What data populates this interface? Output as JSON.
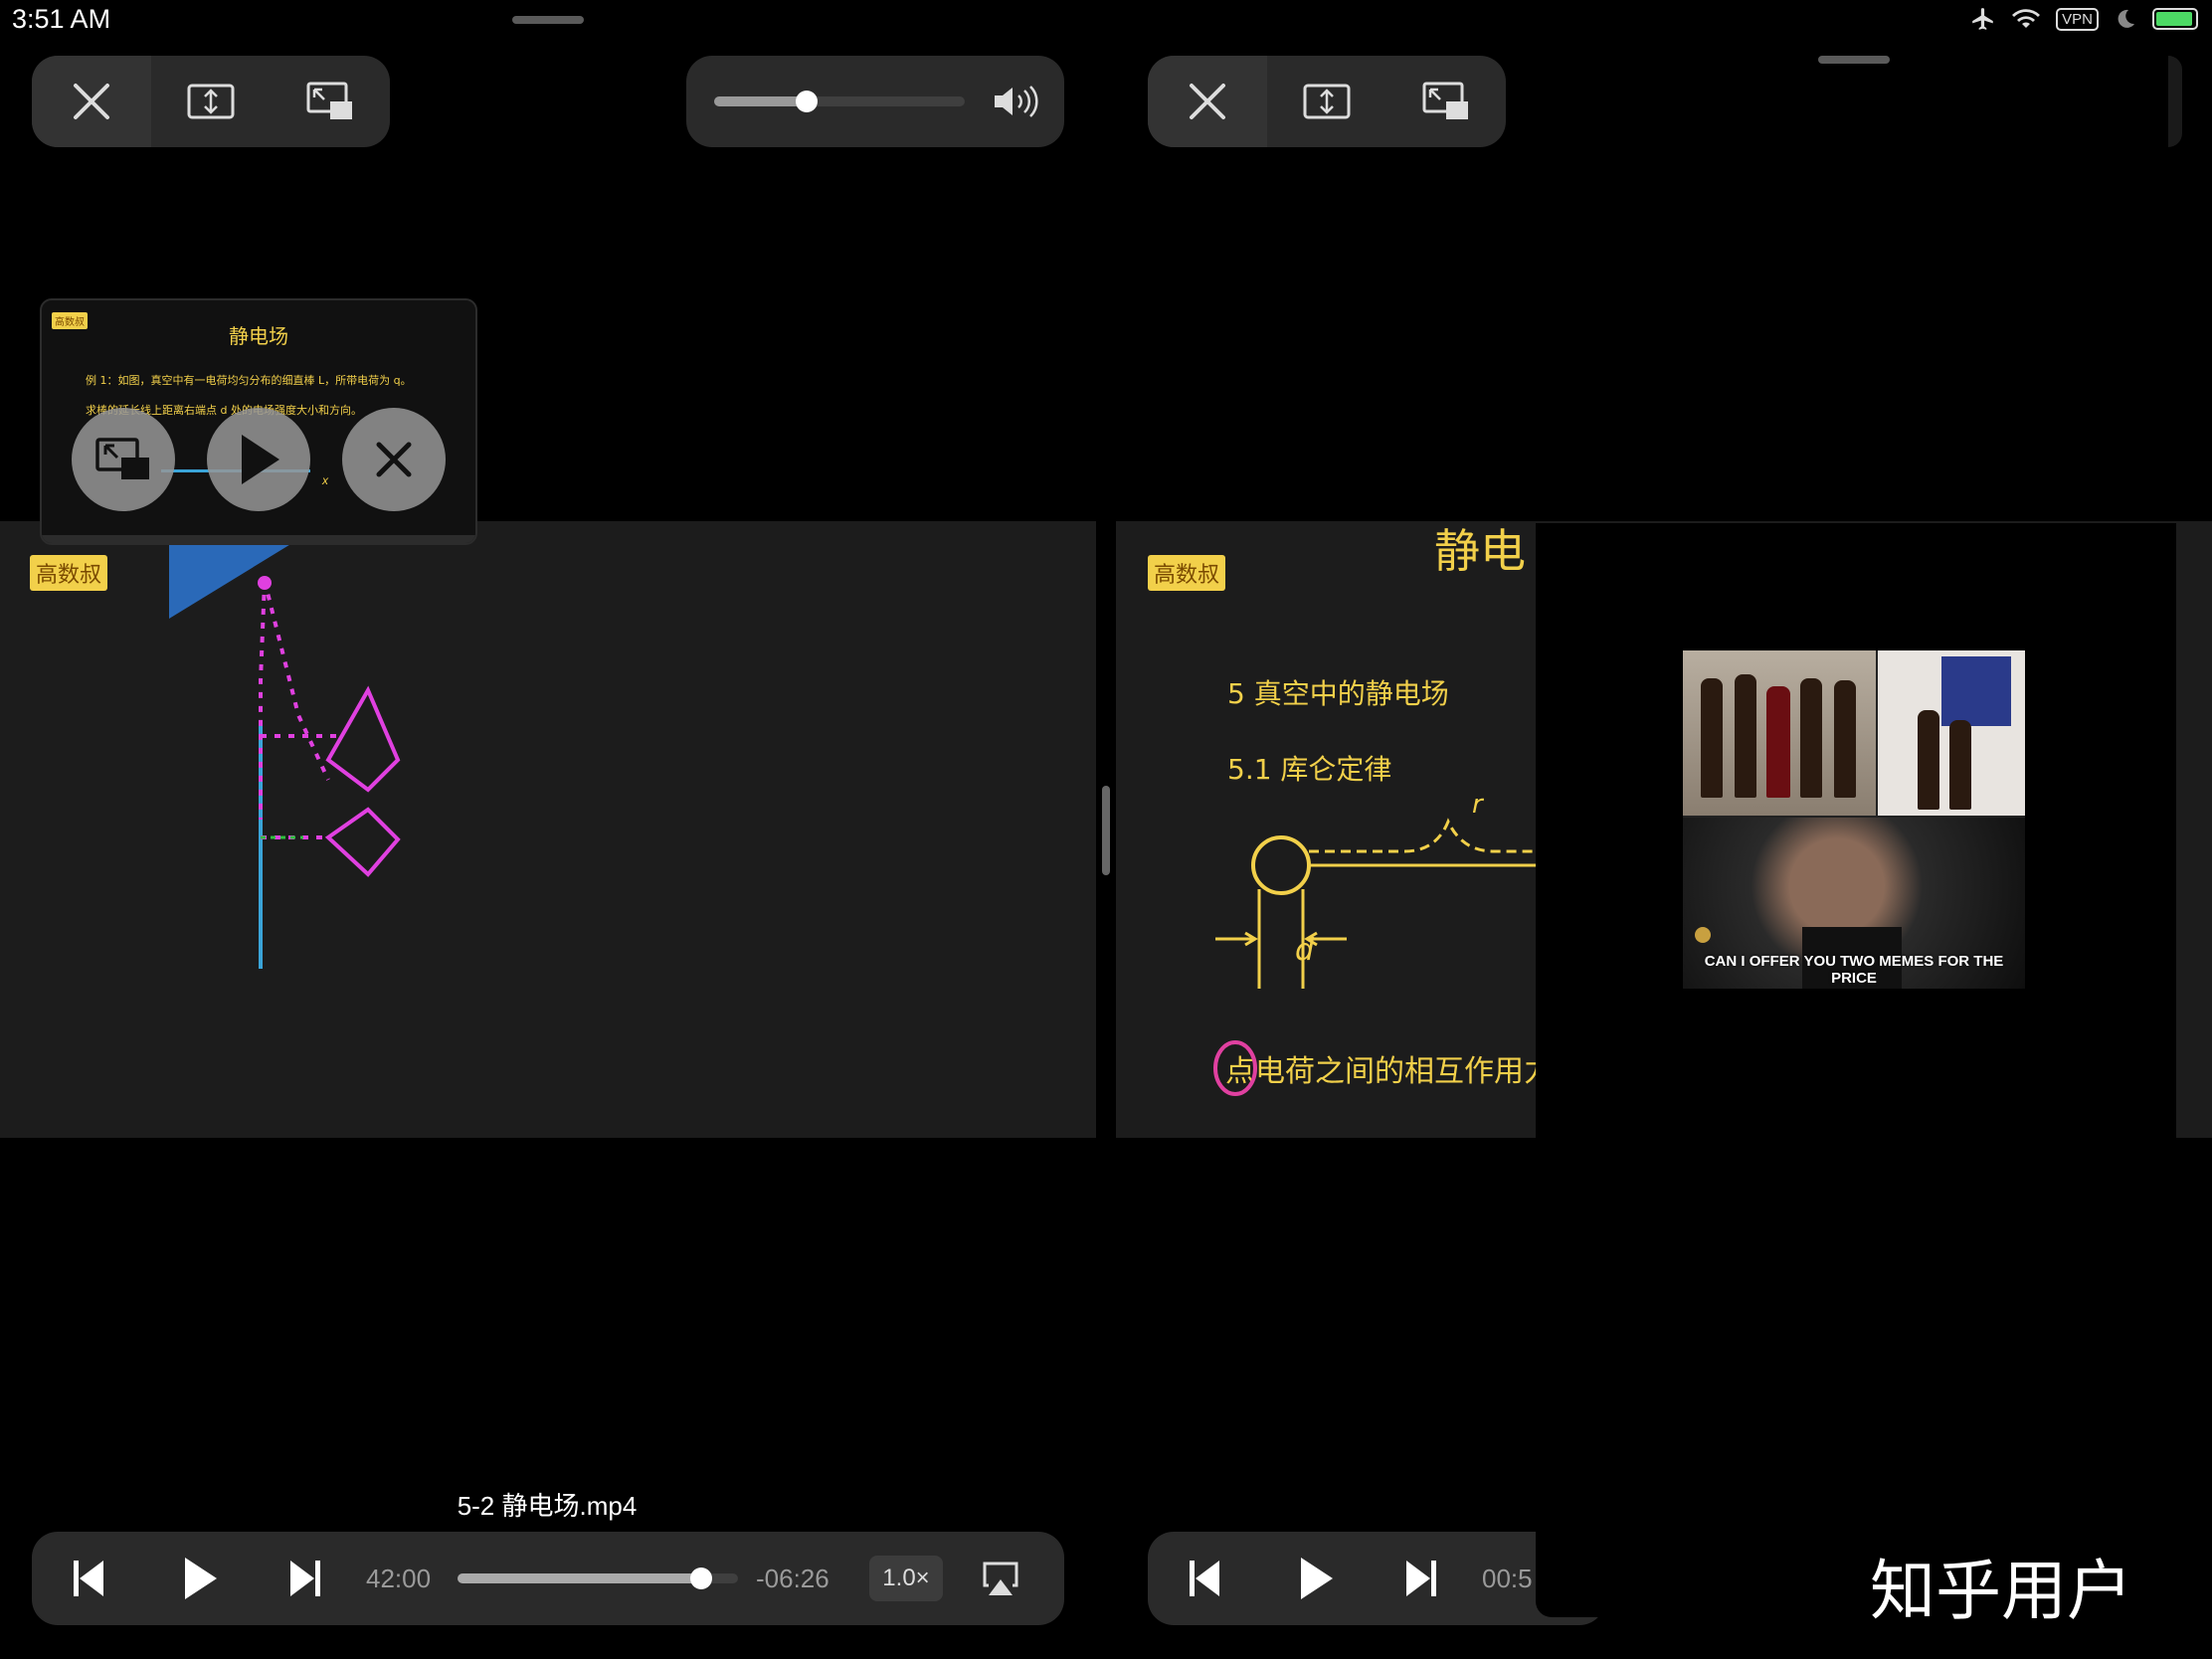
{
  "status_bar": {
    "time": "3:51 AM",
    "vpn": "VPN"
  },
  "left_player": {
    "close_icon": "close-icon",
    "pip_caption": {
      "tag": "高数叔",
      "title": "静电场",
      "line1": "例 1：如图，真空中有一电荷均匀分布的细直棒 L，所带电荷为 q。",
      "line2": "求棒的延长线上距离右端点 d 处的电场强度大小和方向。",
      "axis_label": "x"
    },
    "video": {
      "brand_tag": "高数叔"
    },
    "file_title": "5-2 静电场.mp4",
    "elapsed": "42:00",
    "remaining": "-06:26",
    "speed": "1.0×",
    "progress": 0.87,
    "volume": 0.4
  },
  "right_player": {
    "video": {
      "brand_tag": "高数叔",
      "header": "静电",
      "line1": "5 真空中的静电场",
      "line2": "5.1 库仑定律",
      "label_r": "r",
      "label_d": "d",
      "bottom_line": "点电荷之间的相互作用力"
    },
    "elapsed": "00:5"
  },
  "meme": {
    "caption": "CAN I OFFER YOU TWO MEMES FOR THE PRICE"
  },
  "watermark": "知乎用户"
}
